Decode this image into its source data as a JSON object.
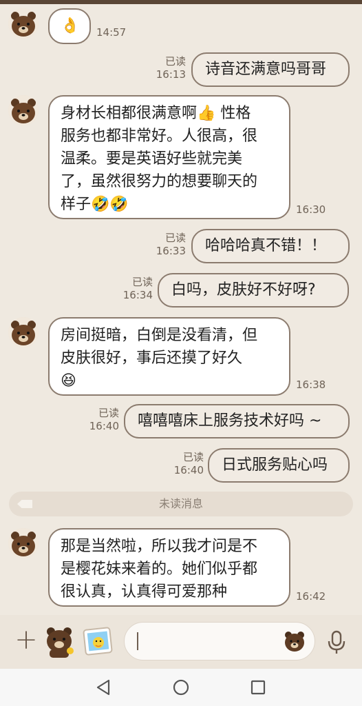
{
  "messages": [
    {
      "from": "other",
      "text": "👌",
      "time": "14:57"
    },
    {
      "from": "me",
      "text": "诗音还满意吗哥哥",
      "read": "已读",
      "time": "16:13"
    },
    {
      "from": "other",
      "lines": [
        "身材长相都很满意啊👍 性格",
        "服务也都非常好。人很高，很",
        "温柔。要是英语好些就完美",
        "了，虽然很努力的想要聊天的",
        "样子🤣🤣"
      ],
      "time": "16:30"
    },
    {
      "from": "me",
      "text": "哈哈哈真不错！！",
      "read": "已读",
      "time": "16:33"
    },
    {
      "from": "me",
      "text": "白吗，皮肤好不好呀?",
      "read": "已读",
      "time": "16:34"
    },
    {
      "from": "other",
      "lines": [
        "房间挺暗，白倒是没看清，但",
        "皮肤很好，事后还摸了好久",
        "😆"
      ],
      "time": "16:38"
    },
    {
      "from": "me",
      "text": "嘻嘻嘻床上服务技术好吗 ~",
      "read": "已读",
      "time": "16:40"
    },
    {
      "from": "me",
      "text": "日式服务贴心吗",
      "read": "已读",
      "time": "16:40"
    },
    {
      "from": "other",
      "lines": [
        "那是当然啦，所以我才问是不",
        "是樱花妹来着的。她们似乎都",
        "很认真，认真得可爱那种"
      ],
      "time": "16:42"
    }
  ],
  "unread_divider": "未读消息",
  "input": {
    "placeholder": "",
    "value": ""
  },
  "icons": {
    "add": "plus-icon",
    "sticker": "sticker-icon",
    "photo": "photo-icon",
    "emoji": "emoji-icon",
    "mic": "microphone-icon",
    "nav_back": "back-triangle-icon",
    "nav_home": "home-circle-icon",
    "nav_recent": "recent-square-icon"
  },
  "colors": {
    "background": "#efe9e0",
    "bubble_border": "#8b7b6e",
    "incoming_bubble": "#ffffff",
    "outgoing_bubble": "#f1ebe3",
    "meta_text": "#6f6357"
  }
}
